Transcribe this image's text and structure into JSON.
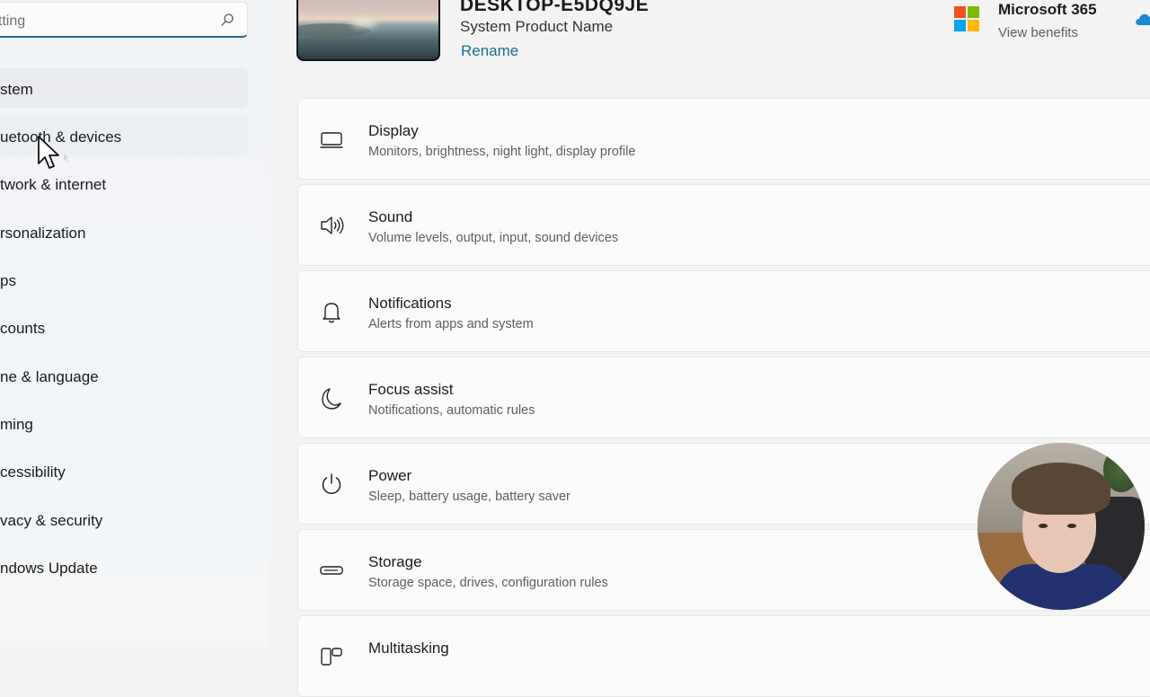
{
  "search": {
    "text": "etting"
  },
  "sidebar": {
    "items": [
      {
        "label": "stem"
      },
      {
        "label": "uetooth & devices"
      },
      {
        "label": "twork & internet"
      },
      {
        "label": "rsonalization"
      },
      {
        "label": "ps"
      },
      {
        "label": "counts"
      },
      {
        "label": "ne & language"
      },
      {
        "label": "ming"
      },
      {
        "label": "cessibility"
      },
      {
        "label": "vacy & security"
      },
      {
        "label": "ndows Update"
      }
    ]
  },
  "header": {
    "device_name": "DESKTOP-E5DQ9JE",
    "device_model": "System Product Name",
    "rename_label": "Rename",
    "ms365_title": "Microsoft 365",
    "ms365_sub": "View benefits"
  },
  "cards": [
    {
      "icon": "display-icon",
      "title": "Display",
      "subtitle": "Monitors, brightness, night light, display profile"
    },
    {
      "icon": "speaker-icon",
      "title": "Sound",
      "subtitle": "Volume levels, output, input, sound devices"
    },
    {
      "icon": "bell-icon",
      "title": "Notifications",
      "subtitle": "Alerts from apps and system"
    },
    {
      "icon": "moon-icon",
      "title": "Focus assist",
      "subtitle": "Notifications, automatic rules"
    },
    {
      "icon": "power-icon",
      "title": "Power",
      "subtitle": "Sleep, battery usage, battery saver"
    },
    {
      "icon": "storage-icon",
      "title": "Storage",
      "subtitle": "Storage space, drives, configuration rules"
    },
    {
      "icon": "multitasking-icon",
      "title": "Multitasking",
      "subtitle": ""
    }
  ],
  "colors": {
    "accent": "#1b6e8e",
    "search_underline": "#2b6a8b",
    "ms_red": "#f25022",
    "ms_green": "#7fba00",
    "ms_blue": "#00a4ef",
    "ms_yellow": "#ffb900"
  }
}
